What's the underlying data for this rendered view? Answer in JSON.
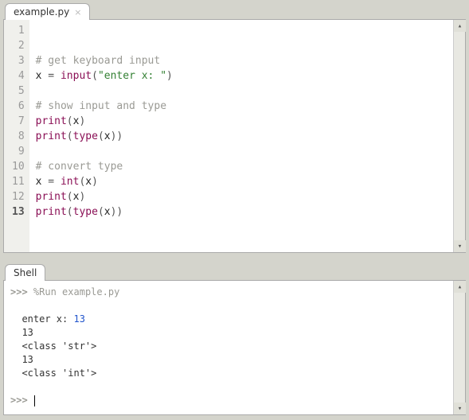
{
  "editor": {
    "tab_label": "example.py",
    "line_count": 13,
    "current_line": 13,
    "lines": {
      "l2": {
        "comment": "# get keyboard input"
      },
      "l3": {
        "var": "x",
        "op": " = ",
        "fn": "input",
        "lp": "(",
        "str": "\"enter x: \"",
        "rp": ")"
      },
      "l5": {
        "comment": "# show input and type"
      },
      "l6": {
        "fn": "print",
        "lp": "(",
        "arg": "x",
        "rp": ")"
      },
      "l7": {
        "fn": "print",
        "lp": "(",
        "fn2": "type",
        "lp2": "(",
        "arg": "x",
        "rp2": ")",
        "rp": ")"
      },
      "l9": {
        "comment": "# convert type"
      },
      "l10": {
        "var": "x",
        "op": " = ",
        "fn": "int",
        "lp": "(",
        "arg": "x",
        "rp": ")"
      },
      "l11": {
        "fn": "print",
        "lp": "(",
        "arg": "x",
        "rp": ")"
      },
      "l12": {
        "fn": "print",
        "lp": "(",
        "fn2": "type",
        "lp2": "(",
        "arg": "x",
        "rp2": ")",
        "rp": ")"
      }
    }
  },
  "shell": {
    "tab_label": "Shell",
    "prompt": ">>>",
    "run_cmd": "%Run example.py",
    "out_prompt": "  enter x: ",
    "user_input": "13",
    "out1": "  13",
    "out2": "  <class 'str'>",
    "out3": "  13",
    "out4": "  <class 'int'>"
  }
}
